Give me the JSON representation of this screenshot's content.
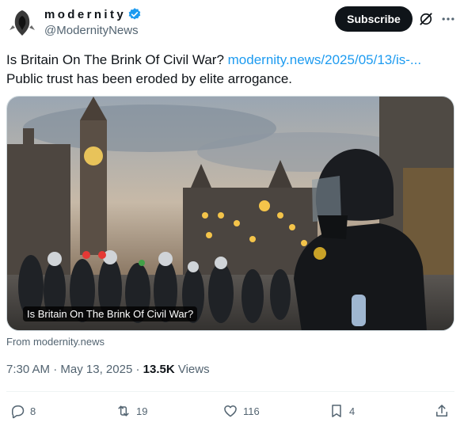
{
  "author": {
    "display_name": "modernity",
    "handle": "@ModernityNews",
    "avatar_icon": "hooded-figure-avatar",
    "verified_icon": "verified-badge-icon",
    "verified_color": "#1d9bf0"
  },
  "header": {
    "subscribe_label": "Subscribe",
    "grok_icon": "grok-icon",
    "more_icon": "more-icon"
  },
  "tweet": {
    "text_line1": "Is Britain On The Brink Of Civil War? ",
    "link_text": "modernity.news/2025/05/13/is-...",
    "text_line2": "Public trust has been eroded by elite arrogance."
  },
  "card": {
    "title": "Is Britain On The Brink Of Civil War?",
    "source": "From modernity.news",
    "image_description_icon": "riot-police-westminster-photo"
  },
  "meta": {
    "time": "7:30 AM",
    "separator": " · ",
    "date": "May 13, 2025",
    "views_count": "13.5K",
    "views_label": " Views"
  },
  "actions": {
    "reply_count": "8",
    "repost_count": "19",
    "like_count": "116",
    "bookmark_count": "4"
  },
  "colors": {
    "text_primary": "#0f1419",
    "text_secondary": "#536471",
    "link": "#1d9bf0",
    "button_bg": "#0f1419"
  }
}
